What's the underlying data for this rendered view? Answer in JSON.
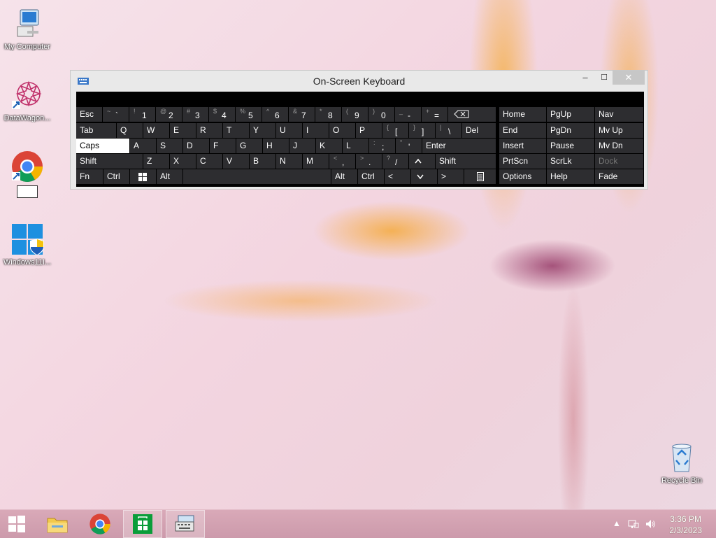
{
  "desktop": {
    "icons": [
      {
        "label": "My Computer",
        "icon": "computer-icon"
      },
      {
        "label": "DataWagon...",
        "icon": "datawagon-icon"
      },
      {
        "label": "",
        "icon": "chrome-shortcut-icon"
      },
      {
        "label": "Windows11I...",
        "icon": "windows-installer-icon"
      },
      {
        "label": "Recycle Bin",
        "icon": "recycle-bin-icon"
      }
    ]
  },
  "osk": {
    "title": "On-Screen Keyboard",
    "minimize": "‒",
    "maximize": "☐",
    "close": "✕",
    "row1": [
      {
        "m": "Esc"
      },
      {
        "s": "~",
        "b": "`"
      },
      {
        "s": "!",
        "b": "1"
      },
      {
        "s": "@",
        "b": "2"
      },
      {
        "s": "#",
        "b": "3"
      },
      {
        "s": "$",
        "b": "4"
      },
      {
        "s": "%",
        "b": "5"
      },
      {
        "s": "^",
        "b": "6"
      },
      {
        "s": "&",
        "b": "7"
      },
      {
        "s": "*",
        "b": "8"
      },
      {
        "s": "(",
        "b": "9"
      },
      {
        "s": ")",
        "b": "0"
      },
      {
        "s": "_",
        "b": "-"
      },
      {
        "s": "+",
        "b": "="
      }
    ],
    "row2": [
      "Tab",
      "Q",
      "W",
      "E",
      "R",
      "T",
      "Y",
      "U",
      "I",
      "O",
      "P"
    ],
    "row2_sym": [
      {
        "s": "{",
        "b": "["
      },
      {
        "s": "}",
        "b": "]"
      },
      {
        "s": "|",
        "b": "\\"
      }
    ],
    "del": "Del",
    "row3": [
      "Caps",
      "A",
      "S",
      "D",
      "F",
      "G",
      "H",
      "J",
      "K",
      "L"
    ],
    "row3_sym": [
      {
        "s": ":",
        "b": ";"
      },
      {
        "s": "\"",
        "b": "'"
      }
    ],
    "enter": "Enter",
    "row4": [
      "Shift",
      "Z",
      "X",
      "C",
      "V",
      "B",
      "N",
      "M"
    ],
    "row4_sym": [
      {
        "s": "<",
        "b": ","
      },
      {
        "s": ">",
        "b": "."
      },
      {
        "s": "?",
        "b": "/"
      }
    ],
    "shift_right": "Shift",
    "row5": {
      "fn": "Fn",
      "ctrl": "Ctrl",
      "alt": "Alt",
      "alt_right": "Alt",
      "ctrl_right": "Ctrl",
      "left": "<",
      "right": ">"
    },
    "nav": [
      [
        "Home",
        "PgUp",
        "Nav"
      ],
      [
        "End",
        "PgDn",
        "Mv Up"
      ],
      [
        "Insert",
        "Pause",
        "Mv Dn"
      ],
      [
        "PrtScn",
        "ScrLk",
        "Dock"
      ],
      [
        "Options",
        "Help",
        "Fade"
      ]
    ]
  },
  "taskbar": {
    "time": "3:36 PM",
    "date": "2/3/2023"
  }
}
